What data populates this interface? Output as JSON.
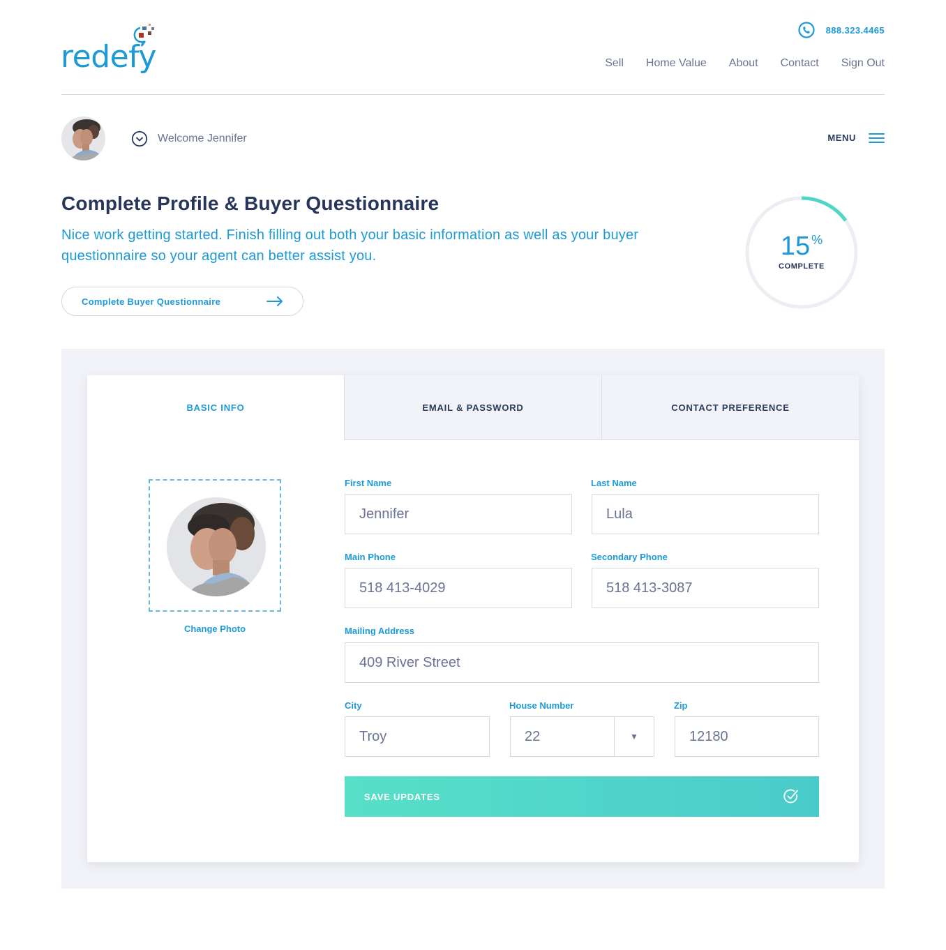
{
  "brand": {
    "name": "redefy",
    "accent": "#1d9ad6",
    "navy": "#263559",
    "teal": "#4fd6c6"
  },
  "header": {
    "phone_icon": "phone-icon",
    "phone": "888.323.4465",
    "nav": [
      {
        "label": "Sell"
      },
      {
        "label": "Home Value"
      },
      {
        "label": "About"
      },
      {
        "label": "Contact"
      },
      {
        "label": "Sign Out"
      }
    ]
  },
  "user_bar": {
    "welcome": "Welcome Jennifer",
    "menu_label": "MENU",
    "menu_icon": "hamburger-icon",
    "dropdown_icon": "chevron-down-circle-icon"
  },
  "hero": {
    "title": "Complete Profile & Buyer Questionnaire",
    "subtitle": "Nice work getting started. Finish filling out both your basic information as well as your buyer questionnaire so your agent can better assist you.",
    "cta_label": "Complete Buyer Questionnaire",
    "cta_icon": "arrow-right-icon"
  },
  "progress": {
    "value": 15,
    "unit": "%",
    "label": "COMPLETE"
  },
  "tabs": [
    {
      "label": "BASIC INFO",
      "active": true
    },
    {
      "label": "EMAIL & PASSWORD",
      "active": false
    },
    {
      "label": "CONTACT PREFERENCE",
      "active": false
    }
  ],
  "photo": {
    "change_label": "Change Photo"
  },
  "form": {
    "first_name": {
      "label": "First Name",
      "value": "Jennifer"
    },
    "last_name": {
      "label": "Last Name",
      "value": "Lula"
    },
    "main_phone": {
      "label": "Main Phone",
      "value": "518 413-4029"
    },
    "secondary_phone": {
      "label": "Secondary Phone",
      "value": "518 413-3087"
    },
    "mailing_address": {
      "label": "Mailing Address",
      "value": "409 River Street"
    },
    "city": {
      "label": "City",
      "value": "Troy"
    },
    "house_number": {
      "label": "House Number",
      "value": "22"
    },
    "zip": {
      "label": "Zip",
      "value": "12180"
    },
    "save_label": "SAVE UPDATES",
    "save_icon": "check-circle-icon"
  }
}
